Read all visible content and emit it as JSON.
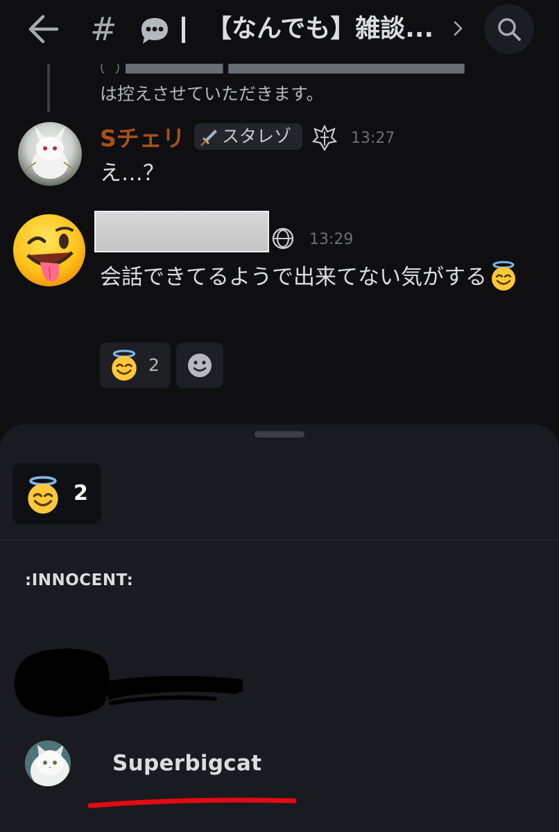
{
  "header": {
    "title": "【なんでも】雑談...",
    "hash_symbol": "#",
    "channel_icon": "speech-bubble-icon"
  },
  "reply": {
    "text": "は控えさせていただきます。"
  },
  "messages": [
    {
      "author": "Sチェリ",
      "author_color": "#a6501c",
      "role_tag": "スタレゾ",
      "time": "13:27",
      "text": "え…？"
    },
    {
      "author": "",
      "time": "13:29",
      "text": "会話できてるようで出来てない気がする",
      "avatar_icon": "winking-tongue-emoji-icon"
    }
  ],
  "reactions": [
    {
      "emoji": "smiling-face-with-halo-icon",
      "count": "2"
    }
  ],
  "sheet": {
    "tab": {
      "emoji": "smiling-face-with-halo-icon",
      "count": "2"
    },
    "section_label": ":INNOCENT:",
    "users": [
      {
        "name": "",
        "redacted": true
      },
      {
        "name": "Superbigcat"
      }
    ]
  },
  "colors": {
    "background": "#0f0f11",
    "sheet": "#1a1b20",
    "highlight_underline": "#e50914"
  }
}
